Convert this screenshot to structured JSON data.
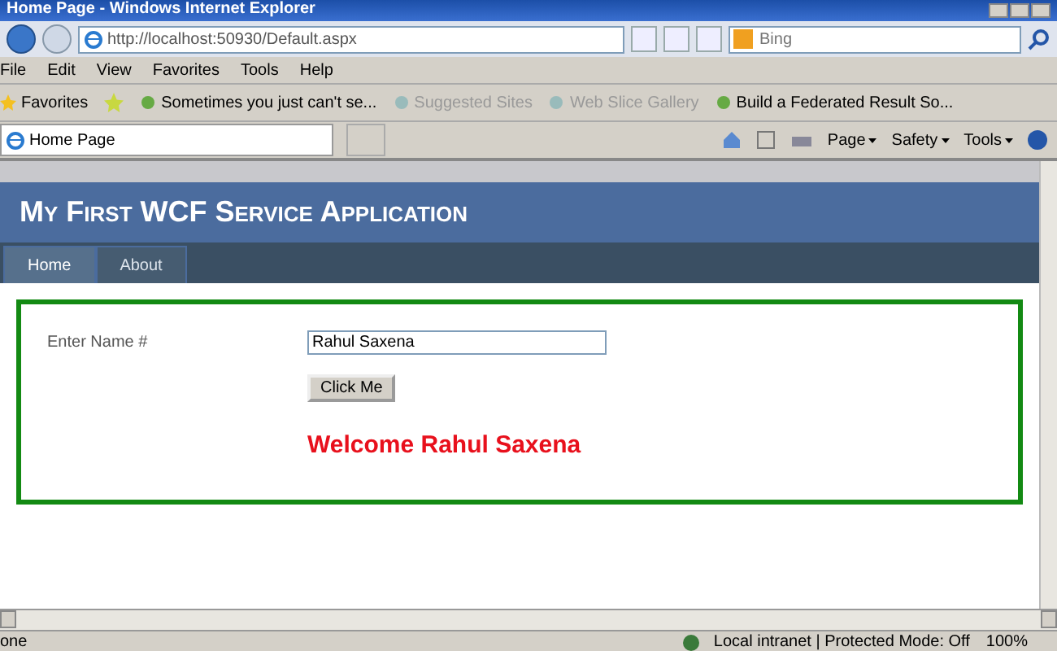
{
  "window": {
    "title": "Home Page - Windows Internet Explorer"
  },
  "address_bar": {
    "url": "http://localhost:50930/Default.aspx",
    "search_placeholder": "Bing"
  },
  "menu": [
    "File",
    "Edit",
    "View",
    "Favorites",
    "Tools",
    "Help"
  ],
  "favorites_bar": {
    "label": "Favorites",
    "items": [
      {
        "label": "Sometimes you just can't se...",
        "disabled": false
      },
      {
        "label": "Suggested Sites",
        "disabled": true
      },
      {
        "label": "Web Slice Gallery",
        "disabled": true
      },
      {
        "label": "Build a Federated Result So...",
        "disabled": false
      }
    ]
  },
  "tab": {
    "label": "Home Page"
  },
  "command_bar": [
    "Page",
    "Safety",
    "Tools"
  ],
  "page": {
    "title": "My First WCF Service Application",
    "nav": [
      {
        "label": "Home",
        "selected": true
      },
      {
        "label": "About",
        "selected": false
      }
    ],
    "form": {
      "label": "Enter Name #",
      "value": "Rahul Saxena",
      "button": "Click Me",
      "message": "Welcome Rahul Saxena"
    }
  },
  "status_bar": {
    "text": "one",
    "zone": "Local intranet | Protected Mode: Off",
    "zoom": "100%"
  }
}
